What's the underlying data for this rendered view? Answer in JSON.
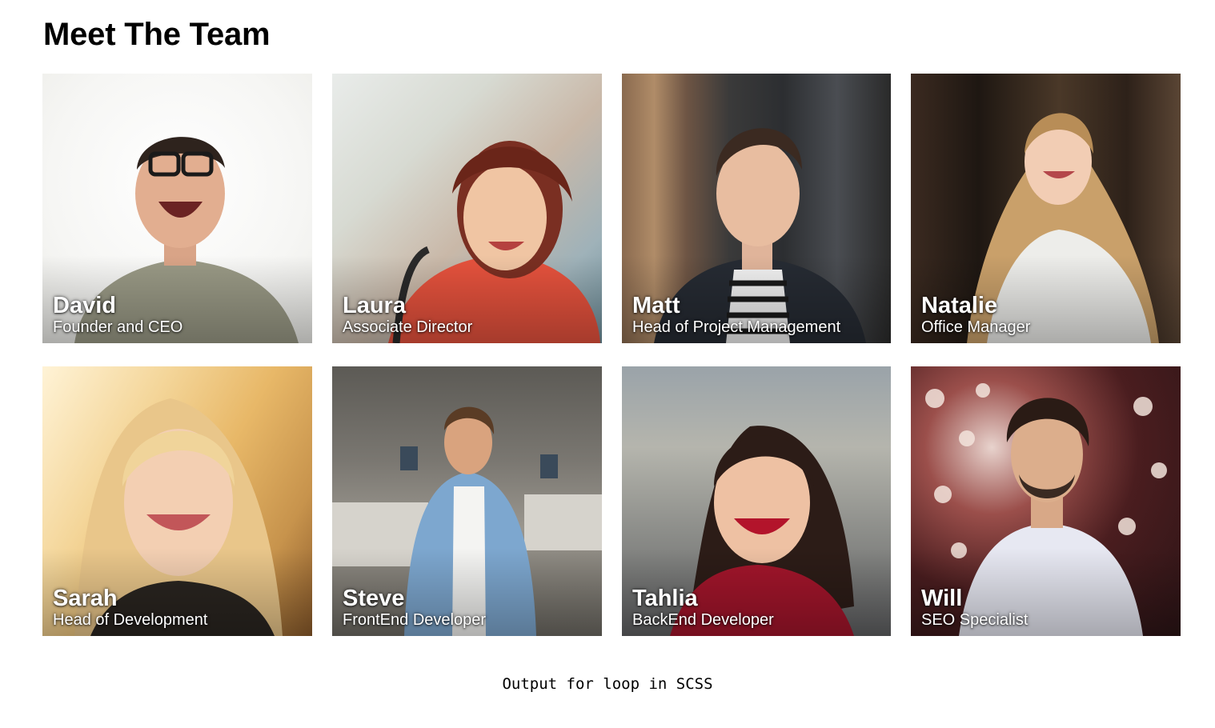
{
  "header": {
    "title": "Meet The Team"
  },
  "team": [
    {
      "name": "David",
      "role": "Founder and CEO"
    },
    {
      "name": "Laura",
      "role": "Associate Director"
    },
    {
      "name": "Matt",
      "role": "Head of Project Management"
    },
    {
      "name": "Natalie",
      "role": "Office Manager"
    },
    {
      "name": "Sarah",
      "role": "Head of Development"
    },
    {
      "name": "Steve",
      "role": "FrontEnd Developer"
    },
    {
      "name": "Tahlia",
      "role": "BackEnd Developer"
    },
    {
      "name": "Will",
      "role": "SEO Specialist"
    }
  ],
  "footer": {
    "text": "Output for loop in SCSS"
  }
}
